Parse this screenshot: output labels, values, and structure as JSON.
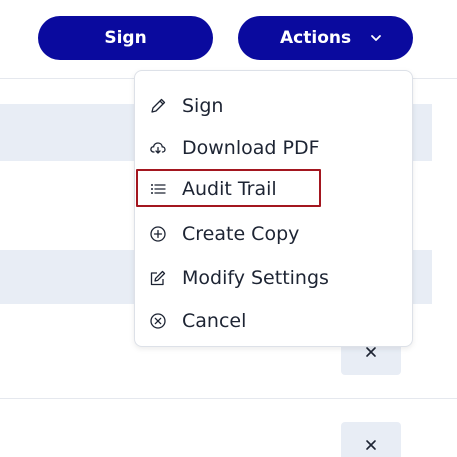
{
  "toolbar": {
    "sign_label": "Sign",
    "actions_label": "Actions"
  },
  "menu": {
    "items": [
      {
        "label": "Sign",
        "icon": "pencil-icon"
      },
      {
        "label": "Download PDF",
        "icon": "cloud-download-icon"
      },
      {
        "label": "Audit Trail",
        "icon": "list-icon"
      },
      {
        "label": "Create Copy",
        "icon": "circle-plus-icon"
      },
      {
        "label": "Modify Settings",
        "icon": "edit-square-icon"
      },
      {
        "label": "Cancel",
        "icon": "circle-x-icon"
      }
    ],
    "highlighted_item": "Audit Trail"
  },
  "colors": {
    "primary": "#0a0a9e",
    "highlight_border": "#a3161f",
    "band": "#e8edf5"
  }
}
